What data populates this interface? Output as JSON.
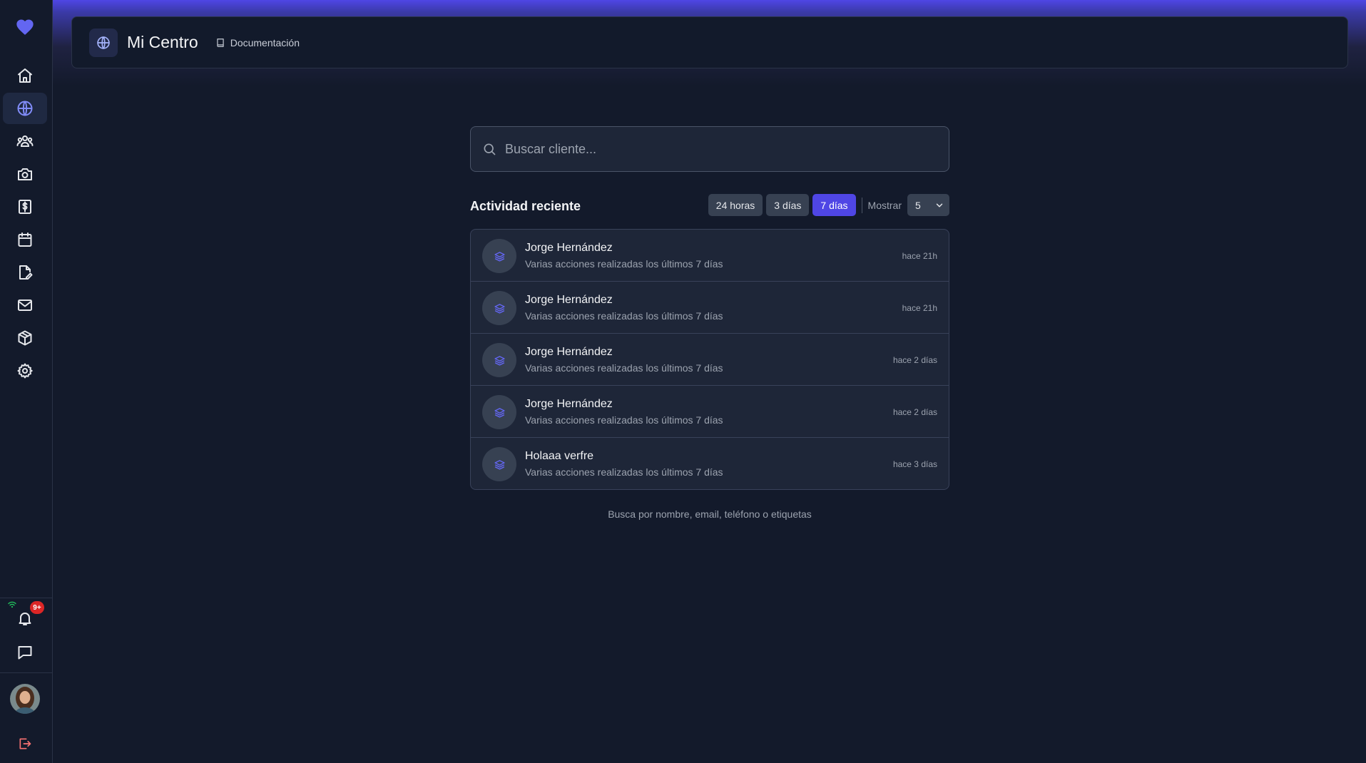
{
  "header": {
    "title": "Mi Centro",
    "doc_link": "Documentación"
  },
  "sidebar": {
    "items": [
      {
        "icon": "home-icon",
        "active": false
      },
      {
        "icon": "globe-icon",
        "active": true
      },
      {
        "icon": "users-icon",
        "active": false
      },
      {
        "icon": "camera-icon",
        "active": false
      },
      {
        "icon": "dollar-document-icon",
        "active": false
      },
      {
        "icon": "calendar-icon",
        "active": false
      },
      {
        "icon": "edit-document-icon",
        "active": false
      },
      {
        "icon": "mail-icon",
        "active": false
      },
      {
        "icon": "package-icon",
        "active": false
      },
      {
        "icon": "settings-icon",
        "active": false
      }
    ],
    "notifications_badge": "9+"
  },
  "search": {
    "placeholder": "Buscar cliente..."
  },
  "activity": {
    "title": "Actividad reciente",
    "filters": [
      "24 horas",
      "3 días",
      "7 días"
    ],
    "active_filter": "7 días",
    "show_label": "Mostrar",
    "show_value": "5",
    "rows": [
      {
        "name": "Jorge Hernández",
        "description": "Varias acciones realizadas los últimos 7 días",
        "time": "hace 21h"
      },
      {
        "name": "Jorge Hernández",
        "description": "Varias acciones realizadas los últimos 7 días",
        "time": "hace 21h"
      },
      {
        "name": "Jorge Hernández",
        "description": "Varias acciones realizadas los últimos 7 días",
        "time": "hace 2 días"
      },
      {
        "name": "Jorge Hernández",
        "description": "Varias acciones realizadas los últimos 7 días",
        "time": "hace 2 días"
      },
      {
        "name": "Holaaa verfre",
        "description": "Varias acciones realizadas los últimos 7 días",
        "time": "hace 3 días"
      }
    ]
  },
  "hint": "Busca por nombre, email, teléfono o etiquetas",
  "colors": {
    "accent": "#4f46e5",
    "background": "#131a2b",
    "card": "#1e2638",
    "logout": "#f87171",
    "logo": "#6366f1"
  }
}
